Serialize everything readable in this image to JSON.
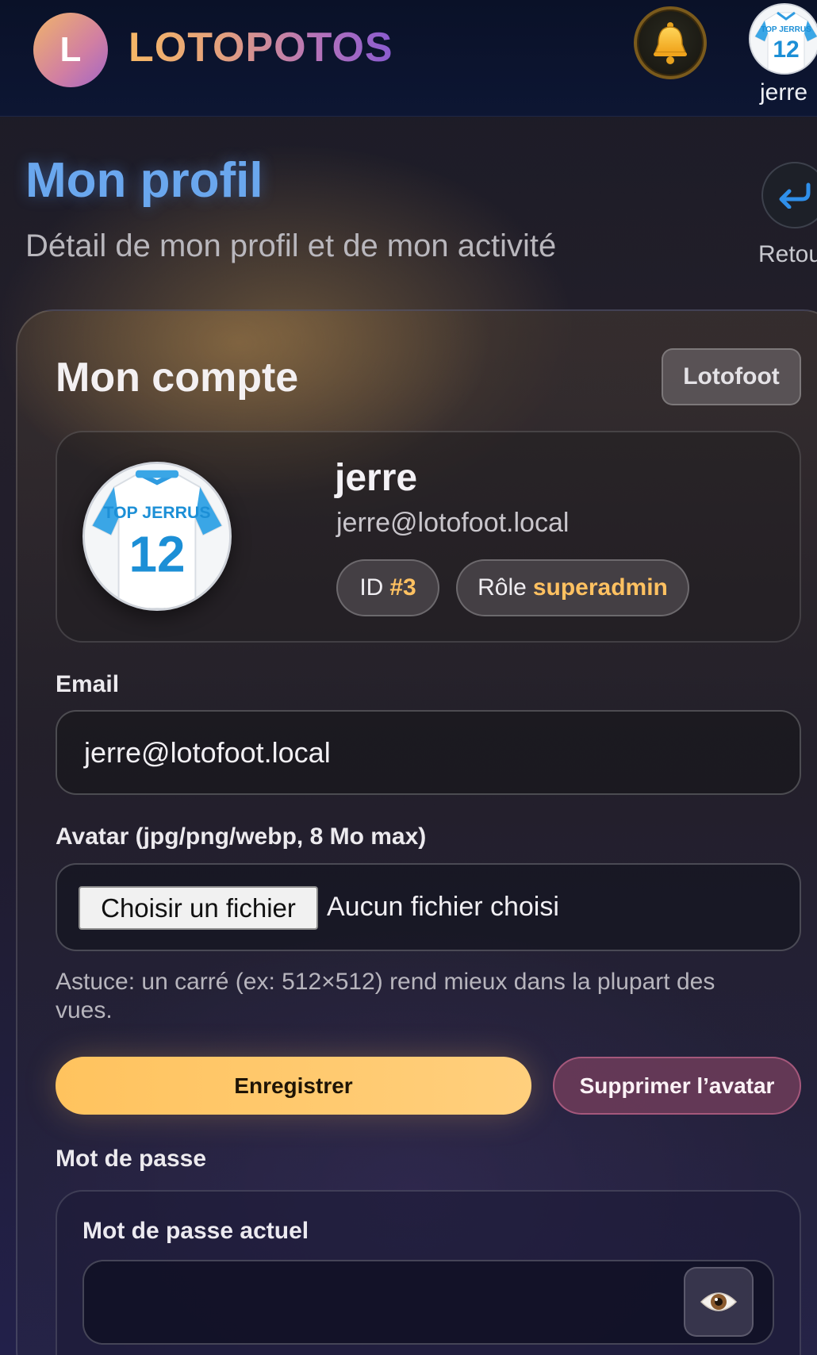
{
  "topbar": {
    "logo_letter": "L",
    "brand": "LOTOPOTOS",
    "bell_icon": "bell-icon",
    "username": "jerre",
    "avatar_jersey_text": "TOP JERRUS",
    "avatar_jersey_number": "12"
  },
  "header": {
    "title": "Mon profil",
    "subtitle": "Détail de mon profil et de mon activité",
    "back_label": "Retour"
  },
  "account": {
    "title": "Mon compte",
    "badge": "Lotofoot",
    "profile": {
      "name": "jerre",
      "email": "jerre@lotofoot.local",
      "id_label": "ID",
      "id_value": "#3",
      "role_label": "Rôle",
      "role_value": "superadmin",
      "jersey_text": "TOP JERRUS",
      "jersey_number": "12"
    },
    "email_field": {
      "label": "Email",
      "value": "jerre@lotofoot.local"
    },
    "avatar_field": {
      "label": "Avatar (jpg/png/webp, 8 Mo max)",
      "button": "Choisir un fichier",
      "status": "Aucun fichier choisi",
      "hint": "Astuce: un carré (ex: 512×512) rend mieux dans la plupart des vues."
    },
    "actions": {
      "save": "Enregistrer",
      "delete_avatar": "Supprimer l’avatar"
    },
    "password": {
      "section_label": "Mot de passe",
      "current_label": "Mot de passe actuel",
      "current_value": ""
    }
  },
  "colors": {
    "accent_title": "#6aa7ee",
    "accent_gold": "#ffc161",
    "save_button": "#ffc35e"
  }
}
